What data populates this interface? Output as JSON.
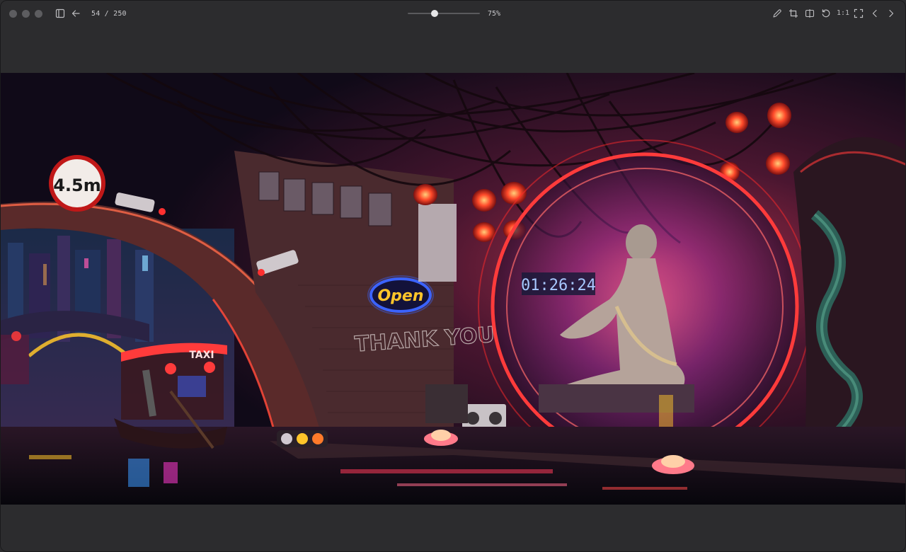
{
  "toolbar": {
    "counter": "54 / 250",
    "zoom_label": "75%",
    "zoom_percent": 75,
    "one_to_one_label": "1:1"
  },
  "image": {
    "sign_height": "4.5m",
    "neon_open": "Open",
    "taxi_sign": "TAXI",
    "display_clock": "01:26:24",
    "graffiti": "THANK YOU"
  },
  "icons": {
    "sidebar": "sidebar-toggle-icon",
    "back": "arrow-left-icon",
    "edit": "pencil-icon",
    "crop": "crop-icon",
    "compare": "split-view-icon",
    "rotate": "rotate-icon",
    "fullscreen": "fullscreen-icon",
    "prev": "chevron-left-icon",
    "next": "chevron-right-icon"
  },
  "colors": {
    "chrome": "#2c2c2e",
    "icon": "#bdbdc0",
    "neon_red": "#ff3b3b",
    "neon_blue": "#3b63ff",
    "neon_yellow": "#ffc52a"
  }
}
